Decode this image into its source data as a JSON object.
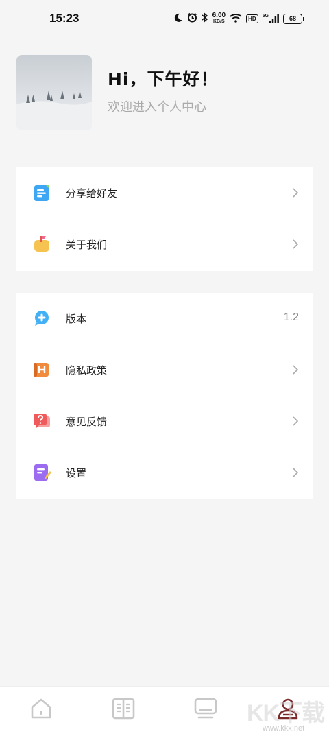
{
  "status_bar": {
    "time": "15:23",
    "net_speed_value": "6.00",
    "net_speed_unit": "KB/S",
    "hd_label": "HD",
    "signal_label": "5G",
    "battery_level": "68"
  },
  "profile": {
    "greeting": "Hi，下午好！",
    "subtitle": "欢迎进入个人中心"
  },
  "menu_group_1": {
    "items": [
      {
        "label": "分享给好友",
        "icon": "share-icon",
        "color": "#3ea6f2"
      },
      {
        "label": "关于我们",
        "icon": "about-icon",
        "color": "#f7c350"
      }
    ]
  },
  "menu_group_2": {
    "items": [
      {
        "label": "版本",
        "icon": "version-icon",
        "color": "#43b0f5",
        "value": "1.2"
      },
      {
        "label": "隐私政策",
        "icon": "privacy-icon",
        "color": "#f08a3c"
      },
      {
        "label": "意见反馈",
        "icon": "feedback-icon",
        "color": "#f05a5a"
      },
      {
        "label": "设置",
        "icon": "settings-icon",
        "color": "#9b6cf0"
      }
    ]
  },
  "bottom_nav": {
    "items": [
      {
        "icon": "home-icon"
      },
      {
        "icon": "book-icon"
      },
      {
        "icon": "monitor-icon"
      },
      {
        "icon": "profile-icon",
        "active": true
      }
    ],
    "active_color": "#7a2a2a",
    "inactive_color": "#c8c8c8"
  },
  "watermark": {
    "text": "KK下载",
    "url": "www.kkx.net"
  }
}
